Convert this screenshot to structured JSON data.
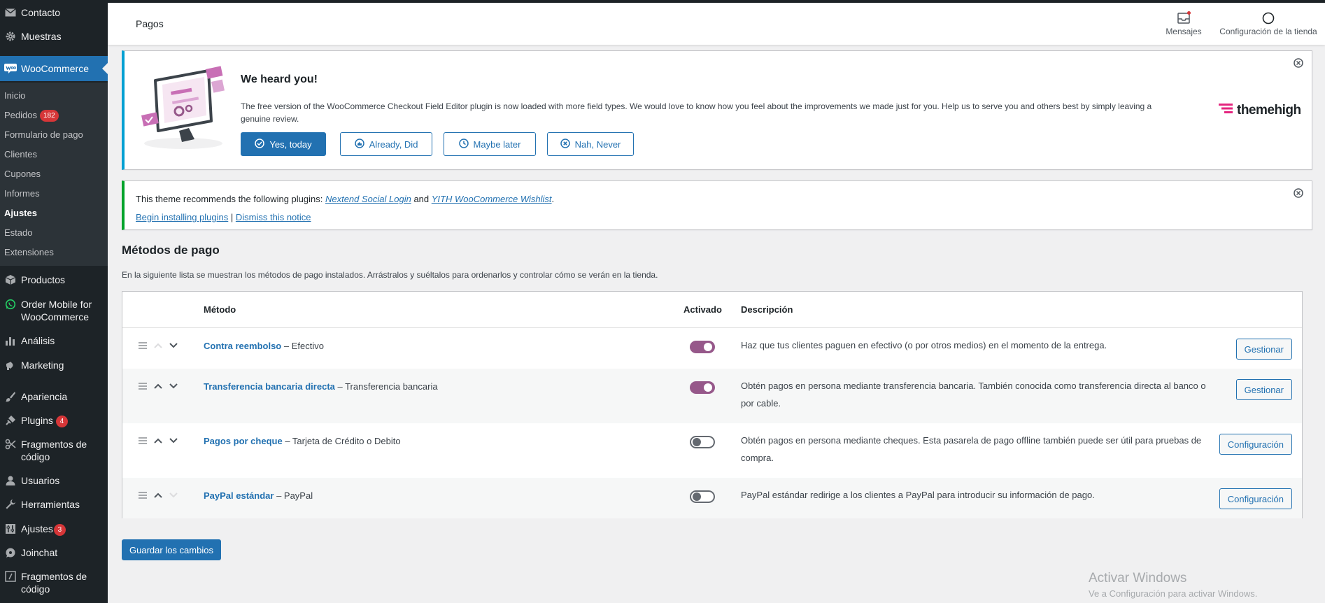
{
  "sidebar": {
    "items": [
      {
        "label": "Contacto",
        "icon": "envelope-icon"
      },
      {
        "label": "Muestras",
        "icon": "gear-icon"
      },
      {
        "label": "WooCommerce",
        "icon": "woocommerce-icon",
        "active": true
      },
      {
        "label": "Productos",
        "icon": "archive-icon"
      },
      {
        "label": "Order Mobile for WooCommerce",
        "icon": "whatsapp-icon"
      },
      {
        "label": "Análisis",
        "icon": "bar-chart-icon"
      },
      {
        "label": "Marketing",
        "icon": "megaphone-icon"
      },
      {
        "label": "Apariencia",
        "icon": "paint-brush-icon"
      },
      {
        "label": "Plugins",
        "icon": "plug-icon",
        "badge": "4"
      },
      {
        "label": "Fragmentos de código",
        "icon": "scissors-icon"
      },
      {
        "label": "Usuarios",
        "icon": "user-icon"
      },
      {
        "label": "Herramientas",
        "icon": "wrench-icon"
      },
      {
        "label": "Ajustes",
        "icon": "settings-icon",
        "badge": "3"
      },
      {
        "label": "Joinchat",
        "icon": "chat-icon"
      },
      {
        "label": "Fragmentos de código",
        "icon": "code-icon"
      }
    ],
    "submenu": [
      {
        "label": "Inicio"
      },
      {
        "label": "Pedidos",
        "badge": "182"
      },
      {
        "label": "Formulario de pago"
      },
      {
        "label": "Clientes"
      },
      {
        "label": "Cupones"
      },
      {
        "label": "Informes"
      },
      {
        "label": "Ajustes",
        "current": true
      },
      {
        "label": "Estado"
      },
      {
        "label": "Extensiones"
      }
    ]
  },
  "header": {
    "title": "Pagos",
    "actions": [
      {
        "label": "Mensajes",
        "icon": "inbox-icon"
      },
      {
        "label": "Configuración de la tienda",
        "icon": "circle-icon"
      }
    ]
  },
  "review_notice": {
    "title": "We heard you!",
    "text": "The free version of the WooCommerce Checkout Field Editor plugin is now loaded with more field types. We would love to know how you feel about the improvements we made just for you. Help us to serve you and others best by simply leaving a genuine review.",
    "buttons": [
      "Yes, today",
      "Already, Did",
      "Maybe later",
      "Nah, Never"
    ],
    "brand": "themehigh"
  },
  "plugins_notice": {
    "prefix": "This theme recommends the following plugins: ",
    "plugin1": "Nextend Social Login",
    "and": " and ",
    "plugin2": "YITH WooCommerce Wishlist",
    "suffix": ".",
    "begin": "Begin installing plugins",
    "sep": " | ",
    "dismiss": "Dismiss this notice"
  },
  "payments": {
    "title": "Métodos de pago",
    "description": "En la siguiente lista se muestran los métodos de pago instalados. Arrástralos y suéltalos para ordenarlos y controlar cómo se verán en la tienda.",
    "columns": {
      "method": "Método",
      "enabled": "Activado",
      "description": "Descripción"
    },
    "rows": [
      {
        "name": "Contra reembolso",
        "subtitle": " – Efectivo",
        "enabled": true,
        "description": "Haz que tus clientes paguen en efectivo (o por otros medios) en el momento de la entrega.",
        "action": "Gestionar"
      },
      {
        "name": "Transferencia bancaria directa",
        "subtitle": " – Transferencia bancaria",
        "enabled": true,
        "description": "Obtén pagos en persona mediante transferencia bancaria. También conocida como transferencia directa al banco o por cable.",
        "action": "Gestionar"
      },
      {
        "name": "Pagos por cheque",
        "subtitle": " – Tarjeta de Crédito o Debito",
        "enabled": false,
        "description": "Obtén pagos en persona mediante cheques. Esta pasarela de pago offline también puede ser útil para pruebas de compra.",
        "action": "Configuración"
      },
      {
        "name": "PayPal estándar",
        "subtitle": " – PayPal",
        "enabled": false,
        "description": "PayPal estándar redirige a los clientes a PayPal para introducir su información de pago.",
        "action": "Configuración"
      }
    ],
    "save_label": "Guardar los cambios"
  },
  "watermark": {
    "line1": "Activar Windows",
    "line2": "Ve a Configuración para activar Windows."
  },
  "colors": {
    "sidebar": "#1d2327",
    "accent": "#2271b1",
    "toggle_on": "#96588a",
    "brand": "#e4267f"
  }
}
